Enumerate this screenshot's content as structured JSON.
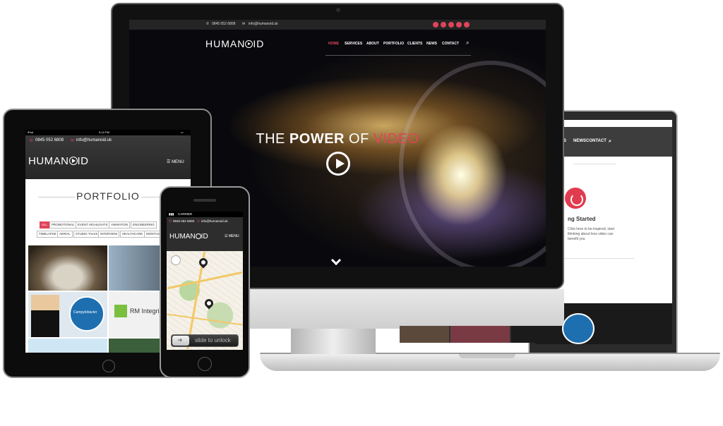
{
  "desktop": {
    "phone": "0845 052 6808",
    "email": "info@humanoid.uk",
    "logo": "HUMAN",
    "logo_end": "ID",
    "nav": [
      "HOME",
      "SERVICES",
      "ABOUT",
      "PORTFOLIO",
      "CLIENTS",
      "NEWS",
      "CONTACT"
    ],
    "active_nav": "HOME",
    "hero_the": "THE",
    "hero_power": "POWER",
    "hero_of": "OF",
    "hero_video": "VIDEO",
    "accent": "#e0445a"
  },
  "laptop": {
    "nav": [
      "S",
      "NEWS",
      "CONTACT"
    ],
    "getting_started": "ng Started",
    "text": "Click here to be inspired, start thinking about how video can benefit you"
  },
  "tablet": {
    "status_left": "iPad",
    "status_time": "5:14 PM",
    "phone": "0845 052 6808",
    "email": "info@humanoid.uk",
    "logo": "HUMAN",
    "logo_end": "ID",
    "menu": "MENU",
    "portfolio_title": "PORTFOLIO",
    "filters_row1": [
      "ALL",
      "PROMOTIONAL",
      "EVENT HIGHLIGHTS",
      "ANIMATION",
      "ENGINEERING"
    ],
    "filters_row2": [
      "TIMELAPSE",
      "AERIAL",
      "STUDIO TALKS",
      "INTERVIEW",
      "HEALTHCARE",
      "MONTAGE"
    ],
    "thumb_labels": [
      "Campylobacter",
      "RM Integris"
    ]
  },
  "phone": {
    "carrier": "CARRIER",
    "phone": "0845 052 6808",
    "email": "info@humanoid.uk",
    "logo": "HUMAN",
    "logo_end": "ID",
    "menu": "MENU",
    "slide_to_unlock": "slide to unlock"
  }
}
